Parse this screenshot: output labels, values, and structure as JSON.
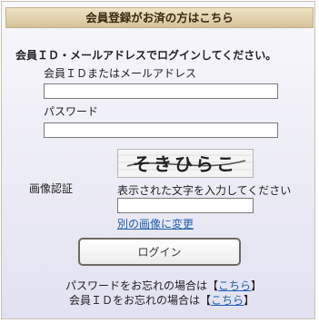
{
  "header": {
    "title": "会員登録がお済の方はこちら"
  },
  "login": {
    "lead": "会員ＩＤ・メールアドレスでログインしてください。",
    "id_label": "会員ＩＤまたはメールアドレス",
    "id_value": "",
    "password_label": "パスワード",
    "password_value": "",
    "captcha": {
      "label": "画像認証",
      "image_text": "そきひらこ",
      "instruction": "表示された文字を入力してください",
      "input_value": "",
      "change_image_link": "別の画像に変更"
    },
    "submit_label": "ログイン"
  },
  "forgot": {
    "password_prefix": "パスワードをお忘れの場合は【",
    "password_link": "こちら",
    "password_suffix": "】",
    "id_prefix": "会員ＩＤをお忘れの場合は【",
    "id_link": "こちら",
    "id_suffix": "】"
  },
  "colors": {
    "header_bg": "#d6c298",
    "link": "#1f5fb0",
    "panel_bg": "#e2e1f1"
  }
}
